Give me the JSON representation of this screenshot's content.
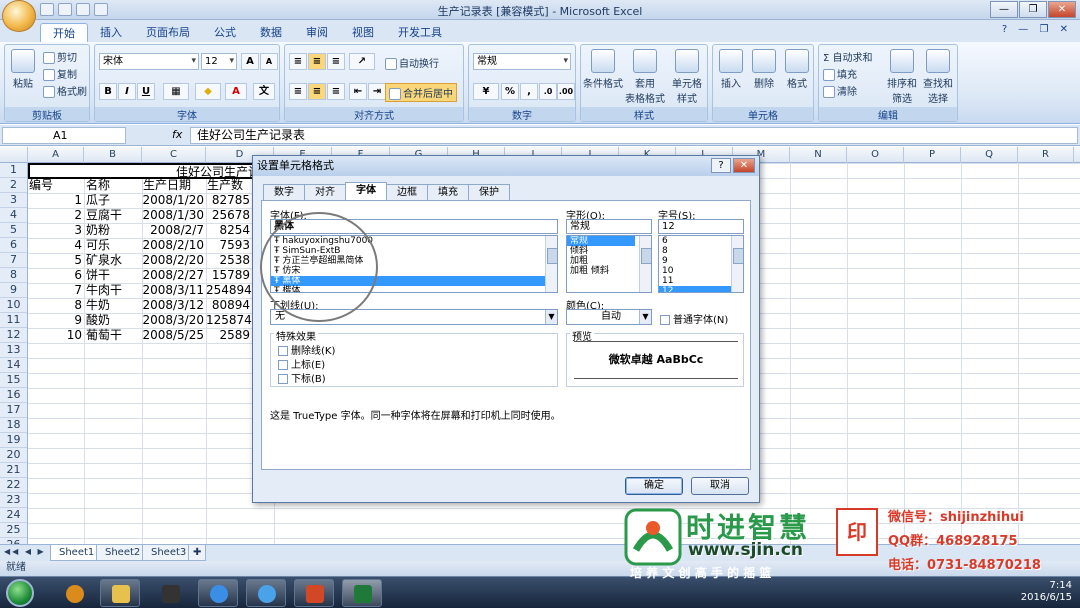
{
  "window": {
    "title": "生产记录表 [兼容模式] - Microsoft Excel",
    "controls": [
      "—",
      "❐",
      "✕"
    ]
  },
  "ribbon_tabs": [
    "开始",
    "插入",
    "页面布局",
    "公式",
    "数据",
    "审阅",
    "视图",
    "开发工具"
  ],
  "ribbon": {
    "clipboard": {
      "paste": "粘贴",
      "cut": "剪切",
      "copy": "复制",
      "format_painter": "格式刷",
      "label": "剪贴板"
    },
    "font": {
      "font_name": "宋体",
      "font_size": "12",
      "grow": "A",
      "shrink": "A",
      "bold": "B",
      "italic": "I",
      "underline": "U",
      "font_color_letter": "A",
      "label": "字体"
    },
    "alignment": {
      "wrap": "自动换行",
      "merge": "合并后居中",
      "label": "对齐方式"
    },
    "number": {
      "format": "常规",
      "percent": "%",
      "comma": ",",
      "label": "数字"
    },
    "styles": {
      "conditional": "条件格式",
      "table_l1": "套用",
      "table_l2": "表格格式",
      "cell_l1": "单元格",
      "cell_l2": "样式",
      "label": "样式"
    },
    "cells": {
      "insert": "插入",
      "delete": "删除",
      "format": "格式",
      "label": "单元格"
    },
    "editing": {
      "autosum": "自动求和",
      "fill": "填充",
      "clear": "清除",
      "sort_l1": "排序和",
      "sort_l2": "筛选",
      "find_l1": "查找和",
      "find_l2": "选择",
      "label": "编辑"
    }
  },
  "formula_bar": {
    "name_box": "A1",
    "fx": "fx",
    "content": "佳好公司生产记录表"
  },
  "columns": [
    "A",
    "B",
    "C",
    "D",
    "E",
    "F",
    "G",
    "H",
    "I",
    "J",
    "K",
    "L",
    "M",
    "N",
    "O",
    "P",
    "Q",
    "R"
  ],
  "rows": [
    "1",
    "2",
    "3",
    "4",
    "5",
    "6",
    "7",
    "8",
    "9",
    "10",
    "11",
    "12",
    "13",
    "14",
    "15",
    "16",
    "17",
    "18",
    "19",
    "20",
    "21",
    "22",
    "23",
    "24",
    "25",
    "26"
  ],
  "sheet": {
    "title": "佳好公司生产记录",
    "headers": [
      "编号",
      "名称",
      "生产日期",
      "生产数"
    ],
    "records": [
      {
        "id": "1",
        "name": "瓜子",
        "date": "2008/1/20",
        "qty": "82785"
      },
      {
        "id": "2",
        "name": "豆腐干",
        "date": "2008/1/30",
        "qty": "25678"
      },
      {
        "id": "3",
        "name": "奶粉",
        "date": "2008/2/7",
        "qty": "8254"
      },
      {
        "id": "4",
        "name": "可乐",
        "date": "2008/2/10",
        "qty": "7593"
      },
      {
        "id": "5",
        "name": "矿泉水",
        "date": "2008/2/20",
        "qty": "2538"
      },
      {
        "id": "6",
        "name": "饼干",
        "date": "2008/2/27",
        "qty": "15789"
      },
      {
        "id": "7",
        "name": "牛肉干",
        "date": "2008/3/11",
        "qty": "254894"
      },
      {
        "id": "8",
        "name": "牛奶",
        "date": "2008/3/12",
        "qty": "80894"
      },
      {
        "id": "9",
        "name": "酸奶",
        "date": "2008/3/20",
        "qty": "125874"
      },
      {
        "id": "10",
        "name": "葡萄干",
        "date": "2008/5/25",
        "qty": "2589"
      }
    ]
  },
  "sheet_tabs": [
    "Sheet1",
    "Sheet2",
    "Sheet3"
  ],
  "status": "就绪",
  "dialog": {
    "title": "设置单元格格式",
    "help": "?",
    "close": "✕",
    "tabs": [
      "数字",
      "对齐",
      "字体",
      "边框",
      "填充",
      "保护"
    ],
    "font_label": "字体(F):",
    "font_value": "黑体",
    "font_list": [
      "hakuyoxingshu7000",
      "SimSun-ExtB",
      "方正兰亭超细黑简体",
      "仿宋",
      "黑体",
      "楷体"
    ],
    "style_label": "字形(O):",
    "style_value": "常规",
    "style_list": [
      "常规",
      "倾斜",
      "加粗",
      "加粗 倾斜"
    ],
    "size_label": "字号(S):",
    "size_value": "12",
    "size_list": [
      "6",
      "8",
      "9",
      "10",
      "11",
      "12"
    ],
    "underline_label": "下划线(U):",
    "underline_value": "无",
    "color_label": "颜色(C):",
    "color_value": "自动",
    "normal_font": "普通字体(N)",
    "effects_label": "特殊效果",
    "strike": "删除线(K)",
    "superscript": "上标(E)",
    "subscript": "下标(B)",
    "preview_label": "预览",
    "preview_text": "微软卓越  AaBbCc",
    "note": "这是 TrueType 字体。同一种字体将在屏幕和打印机上同时使用。",
    "ok": "确定",
    "cancel": "取消"
  },
  "taskbar": {
    "time": "7:14",
    "date": "2016/6/15"
  },
  "watermark": {
    "brand": "时进智慧",
    "url": "www.sjin.cn",
    "slogan": "培 养 文 创 高 手 的 摇 篮",
    "wechat": "微信号：shijinzhihui",
    "qq": "QQ群：468928175",
    "phone": "电话：0731-84870218"
  },
  "colors": {
    "accent": "#15428b",
    "ribbon": "#dbe6f4",
    "selection": "#3399ff",
    "brand_green": "#2a9a4a",
    "brand_red": "#d83a2a"
  }
}
